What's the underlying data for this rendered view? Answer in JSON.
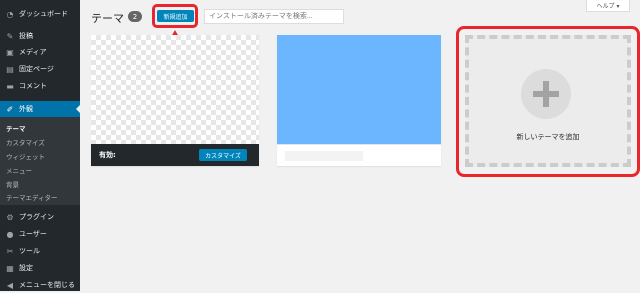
{
  "sidebar": {
    "items": [
      {
        "label": "ダッシュボード",
        "icon": "dashboard-icon"
      },
      {
        "label": "投稿",
        "icon": "pin-icon"
      },
      {
        "label": "メディア",
        "icon": "media-icon"
      },
      {
        "label": "固定ページ",
        "icon": "page-icon"
      },
      {
        "label": "コメント",
        "icon": "comment-icon"
      },
      {
        "label": "外観",
        "icon": "brush-icon"
      },
      {
        "label": "プラグイン",
        "icon": "plugin-icon"
      },
      {
        "label": "ユーザー",
        "icon": "user-icon"
      },
      {
        "label": "ツール",
        "icon": "wrench-icon"
      },
      {
        "label": "設定",
        "icon": "settings-icon"
      },
      {
        "label": "メニューを閉じる",
        "icon": "collapse-icon"
      }
    ],
    "submenu": [
      "テーマ",
      "カスタマイズ",
      "ウィジェット",
      "メニュー",
      "背景",
      "テーマエディター"
    ]
  },
  "header": {
    "title": "テーマ",
    "count": "2",
    "add_new": "新規追加",
    "search_placeholder": "インストール済みテーマを検索...",
    "help": "ヘルプ ▾"
  },
  "active_theme": {
    "label": "有効:",
    "customize": "カスタマイズ"
  },
  "add_tile": {
    "label": "新しいテーマを追加"
  },
  "colors": {
    "sidebar": "#23282d",
    "accent": "#0073aa",
    "highlight": "#e8262b",
    "theme2_preview": "#6cb6ff"
  }
}
